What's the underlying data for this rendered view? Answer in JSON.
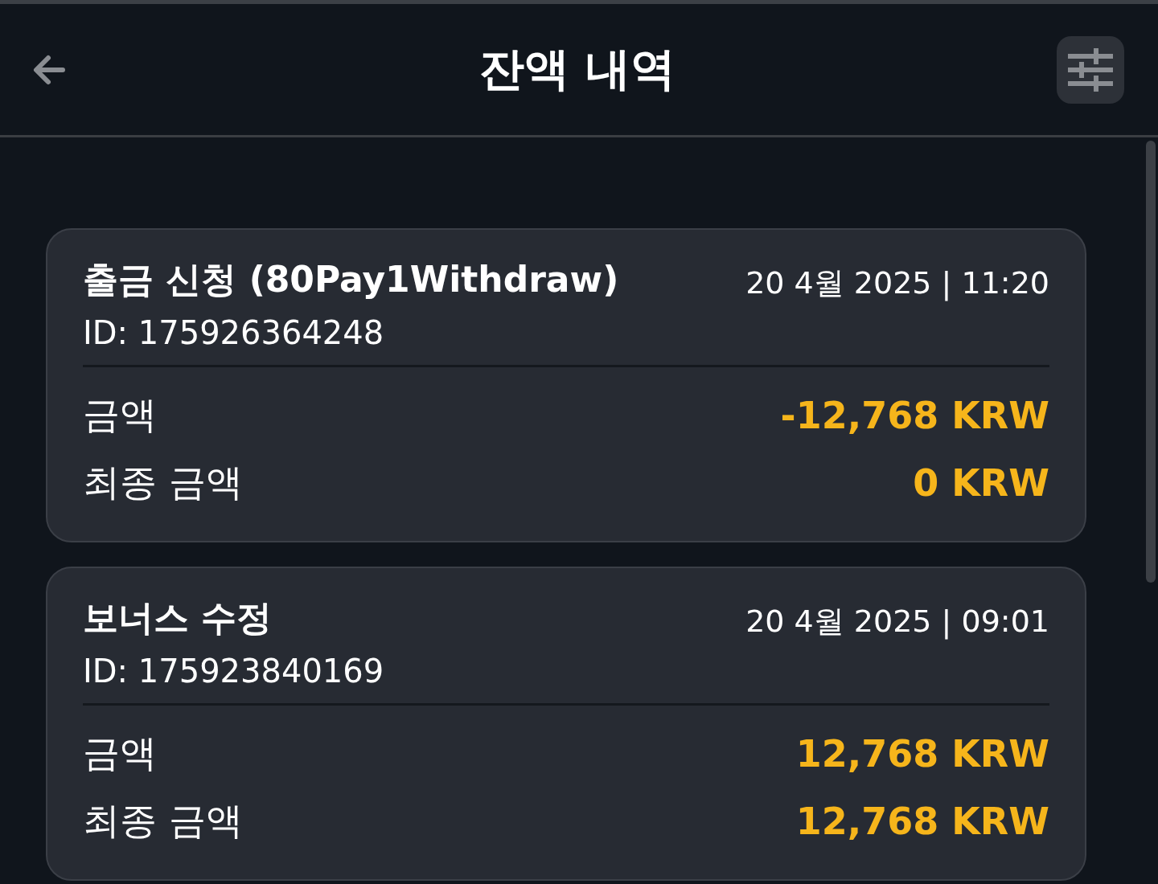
{
  "header": {
    "title": "잔액 내역"
  },
  "transactions": [
    {
      "title": "출금 신청 (80Pay1Withdraw)",
      "datetime": "20 4월 2025 | 11:20",
      "id": "ID: 175926364248",
      "rows": [
        {
          "label": "금액",
          "value": "-12,768 KRW"
        },
        {
          "label": "최종 금액",
          "value": "0 KRW"
        }
      ]
    },
    {
      "title": "보너스 수정",
      "datetime": "20 4월 2025 | 09:01",
      "id": "ID: 175923840169",
      "rows": [
        {
          "label": "금액",
          "value": "12,768 KRW"
        },
        {
          "label": "최종 금액",
          "value": "12,768 KRW"
        }
      ]
    }
  ]
}
